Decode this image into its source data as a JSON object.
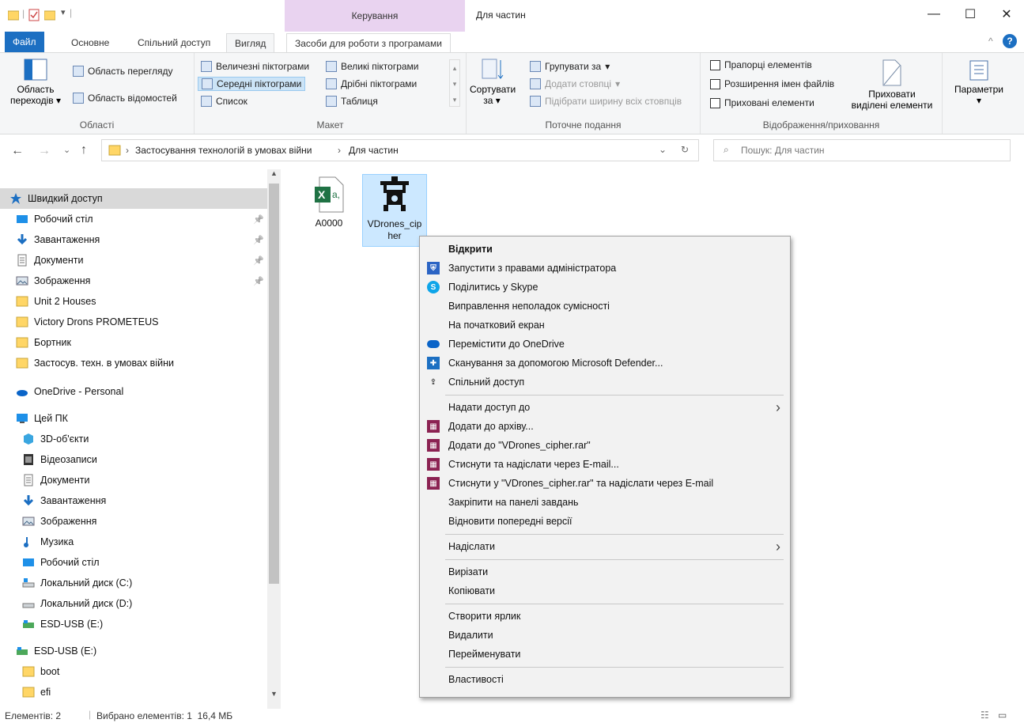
{
  "titlebar": {
    "contextual_tab": "Керування",
    "window_title": "Для частин",
    "minimize": "—",
    "maximize": "☐",
    "close": "✕"
  },
  "tabs": {
    "file": "Файл",
    "home": "Основне",
    "share": "Спільний доступ",
    "view": "Вигляд",
    "app_tools": "Засоби для роботи з програмами"
  },
  "ribbon": {
    "panes": {
      "nav_pane_line1": "Область",
      "nav_pane_line2": "переходів",
      "preview_pane": "Область перегляду",
      "details_pane": "Область відомостей",
      "label": "Області"
    },
    "layout": {
      "extra_large": "Величезні піктограми",
      "large": "Великі піктограми",
      "medium": "Середні піктограми",
      "small": "Дрібні піктограми",
      "list": "Список",
      "details": "Таблиця",
      "label": "Макет"
    },
    "current_view": {
      "sort_line1": "Сортувати",
      "sort_line2": "за",
      "group_by": "Групувати за",
      "add_columns": "Додати стовпці",
      "size_columns": "Підібрати ширину всіх стовпців",
      "label": "Поточне подання"
    },
    "show_hide": {
      "item_checkboxes": "Прапорці елементів",
      "file_extensions": "Розширення імен файлів",
      "hidden_items": "Приховані елементи",
      "hide_selected_line1": "Приховати",
      "hide_selected_line2": "виділені елементи",
      "label": "Відображення/приховання"
    },
    "options": "Параметри"
  },
  "address": {
    "crumb1": "Застосування технологій в умовах війни",
    "crumb2": "Для частин",
    "search_placeholder": "Пошук: Для частин"
  },
  "nav": {
    "quick_access": "Швидкий доступ",
    "items": [
      {
        "label": "Робочий стіл",
        "icon": "desktop-icon",
        "pinned": true
      },
      {
        "label": "Завантаження",
        "icon": "downloads-icon",
        "pinned": true
      },
      {
        "label": "Документи",
        "icon": "documents-icon",
        "pinned": true
      },
      {
        "label": "Зображення",
        "icon": "pictures-icon",
        "pinned": true
      },
      {
        "label": "Unit 2 Houses",
        "icon": "folder-icon",
        "pinned": false
      },
      {
        "label": "Victory Drons PROMETEUS",
        "icon": "folder-icon",
        "pinned": false
      },
      {
        "label": "Бортник",
        "icon": "folder-icon",
        "pinned": false
      },
      {
        "label": "Застосув. техн. в умовах війни",
        "icon": "folder-icon",
        "pinned": false
      }
    ],
    "onedrive": "OneDrive - Personal",
    "this_pc": "Цей ПК",
    "pc_items": [
      {
        "label": "3D-об'єкти",
        "icon": "3d-objects-icon"
      },
      {
        "label": "Відеозаписи",
        "icon": "videos-icon"
      },
      {
        "label": "Документи",
        "icon": "documents-icon"
      },
      {
        "label": "Завантаження",
        "icon": "downloads-icon"
      },
      {
        "label": "Зображення",
        "icon": "pictures-icon"
      },
      {
        "label": "Музика",
        "icon": "music-icon"
      },
      {
        "label": "Робочий стіл",
        "icon": "desktop-icon"
      },
      {
        "label": "Локальний диск (C:)",
        "icon": "drive-c-icon"
      },
      {
        "label": "Локальний диск (D:)",
        "icon": "drive-d-icon"
      },
      {
        "label": "ESD-USB (E:)",
        "icon": "usb-drive-icon"
      }
    ],
    "usb": "ESD-USB (E:)",
    "usb_items": [
      {
        "label": "boot",
        "icon": "folder-icon"
      },
      {
        "label": "efi",
        "icon": "folder-icon"
      }
    ]
  },
  "files": [
    {
      "name": "A0000",
      "icon": "excel-file-icon"
    },
    {
      "name": "VDrones_cipher",
      "icon": "drone-app-icon"
    }
  ],
  "context_menu": [
    {
      "label": "Відкрити",
      "bold": true
    },
    {
      "label": "Запустити з правами адміністратора",
      "icon": "uac-shield-icon"
    },
    {
      "label": "Поділитись у Skype",
      "icon": "skype-icon"
    },
    {
      "label": "Виправлення неполадок сумісності"
    },
    {
      "label": "На початковий екран"
    },
    {
      "label": "Перемістити до OneDrive",
      "icon": "onedrive-icon"
    },
    {
      "label": "Сканування за допомогою Microsoft Defender...",
      "icon": "defender-icon"
    },
    {
      "label": "Спільний доступ",
      "icon": "share-icon"
    },
    {
      "sep": true
    },
    {
      "label": "Надати доступ до",
      "submenu": true
    },
    {
      "label": "Додати до архіву...",
      "icon": "winrar-icon"
    },
    {
      "label": "Додати до \"VDrones_cipher.rar\"",
      "icon": "winrar-icon"
    },
    {
      "label": "Стиснути та надіслати через E-mail...",
      "icon": "winrar-icon"
    },
    {
      "label": "Стиснути у \"VDrones_cipher.rar\" та надіслати через E-mail",
      "icon": "winrar-icon"
    },
    {
      "label": "Закріпити на панелі завдань"
    },
    {
      "label": "Відновити попередні версії"
    },
    {
      "sep": true
    },
    {
      "label": "Надіслати",
      "submenu": true
    },
    {
      "sep": true
    },
    {
      "label": "Вирізати"
    },
    {
      "label": "Копіювати"
    },
    {
      "sep": true
    },
    {
      "label": "Створити ярлик"
    },
    {
      "label": "Видалити"
    },
    {
      "label": "Перейменувати"
    },
    {
      "sep": true
    },
    {
      "label": "Властивості"
    }
  ],
  "status": {
    "items": "Елементів: 2",
    "selected": "Вибрано елементів: 1  16,4 МБ"
  },
  "colors": {
    "accent": "#1c6fc2",
    "selection": "#cce8ff",
    "folder": "#ffd666",
    "context_tab": "#e9d3f0"
  }
}
